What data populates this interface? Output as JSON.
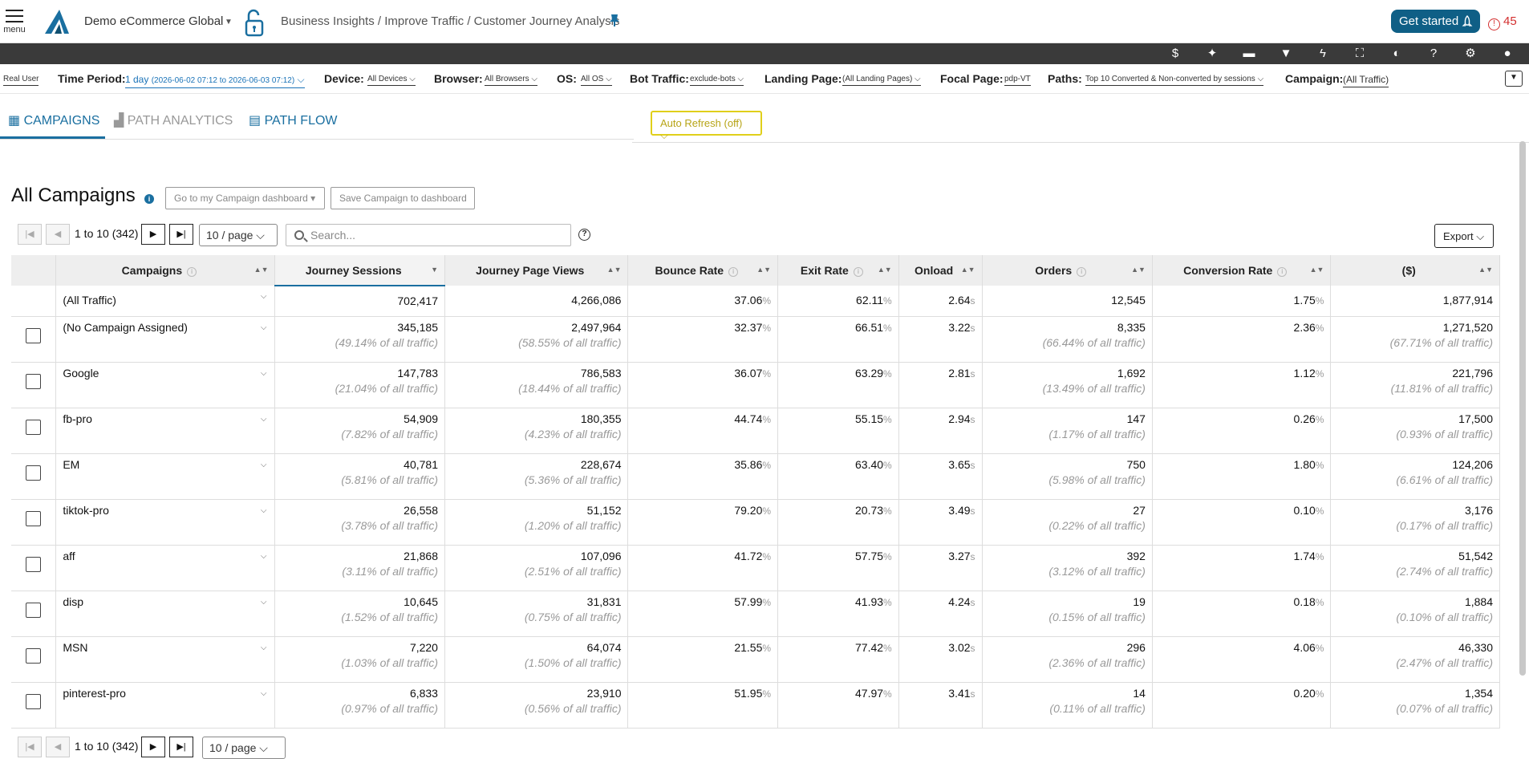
{
  "header": {
    "menu_label": "menu",
    "account": "Demo eCommerce Global",
    "breadcrumb": "Business Insights / Improve Traffic / Customer Journey Analysis",
    "get_started": "Get started",
    "alert_count": "45"
  },
  "toolbar_icons": [
    "dollar-icon",
    "sparkle-icon",
    "comment-icon",
    "filter-icon",
    "bolt-icon",
    "fullscreen-icon",
    "contrast-icon",
    "help-icon",
    "gear-icon",
    "user-icon"
  ],
  "filters": {
    "real_user": "Real User",
    "time_period_label": "Time Period:",
    "time_period_value": "1 day",
    "time_period_range": "(2026-06-02 07:12 to 2026-06-03 07:12)",
    "device_label": "Device:",
    "device_value": "All Devices",
    "browser_label": "Browser:",
    "browser_value": "All Browsers",
    "os_label": "OS:",
    "os_value": "All OS",
    "bot_label": "Bot Traffic:",
    "bot_value": "exclude-bots",
    "landing_label": "Landing Page:",
    "landing_value": "(All Landing Pages)",
    "focal_label": "Focal Page:",
    "focal_value": "pdp-VT",
    "paths_label": "Paths:",
    "paths_value": "Top 10 Converted & Non-converted by sessions",
    "campaign_label": "Campaign:",
    "campaign_value": "(All Traffic)"
  },
  "tabs": [
    "CAMPAIGNS",
    "PATH ANALYTICS",
    "PATH FLOW"
  ],
  "auto_refresh": "Auto Refresh (off)",
  "section": {
    "title": "All Campaigns",
    "goto_button": "Go to my Campaign dashboard",
    "save_button": "Save Campaign to dashboard",
    "search_placeholder": "Search...",
    "export": "Export"
  },
  "pager": {
    "range": "1 to 10 (342)",
    "page_size": "10 / page"
  },
  "table": {
    "columns": [
      "Campaigns",
      "Journey Sessions",
      "Journey Page Views",
      "Bounce Rate",
      "Exit Rate",
      "Onload",
      "Orders",
      "Conversion Rate",
      "($)"
    ],
    "total": {
      "name": "(All Traffic)",
      "sessions": "702,417",
      "pageviews": "4,266,086",
      "bounce": "37.06",
      "exit": "62.11",
      "onload": "2.64",
      "orders": "12,545",
      "conv": "1.75",
      "revenue": "1,877,914"
    },
    "rows": [
      {
        "name": "(No Campaign Assigned)",
        "sessions": "345,185",
        "sessions_pct": "(49.14% of all traffic)",
        "pageviews": "2,497,964",
        "pageviews_pct": "(58.55% of all traffic)",
        "bounce": "32.37",
        "exit": "66.51",
        "onload": "3.22",
        "orders": "8,335",
        "orders_pct": "(66.44% of all traffic)",
        "conv": "2.36",
        "revenue": "1,271,520",
        "revenue_pct": "(67.71% of all traffic)"
      },
      {
        "name": "Google",
        "sessions": "147,783",
        "sessions_pct": "(21.04% of all traffic)",
        "pageviews": "786,583",
        "pageviews_pct": "(18.44% of all traffic)",
        "bounce": "36.07",
        "exit": "63.29",
        "onload": "2.81",
        "orders": "1,692",
        "orders_pct": "(13.49% of all traffic)",
        "conv": "1.12",
        "revenue": "221,796",
        "revenue_pct": "(11.81% of all traffic)"
      },
      {
        "name": "fb-pro",
        "sessions": "54,909",
        "sessions_pct": "(7.82% of all traffic)",
        "pageviews": "180,355",
        "pageviews_pct": "(4.23% of all traffic)",
        "bounce": "44.74",
        "exit": "55.15",
        "onload": "2.94",
        "orders": "147",
        "orders_pct": "(1.17% of all traffic)",
        "conv": "0.26",
        "revenue": "17,500",
        "revenue_pct": "(0.93% of all traffic)"
      },
      {
        "name": "EM",
        "sessions": "40,781",
        "sessions_pct": "(5.81% of all traffic)",
        "pageviews": "228,674",
        "pageviews_pct": "(5.36% of all traffic)",
        "bounce": "35.86",
        "exit": "63.40",
        "onload": "3.65",
        "orders": "750",
        "orders_pct": "(5.98% of all traffic)",
        "conv": "1.80",
        "revenue": "124,206",
        "revenue_pct": "(6.61% of all traffic)"
      },
      {
        "name": "tiktok-pro",
        "sessions": "26,558",
        "sessions_pct": "(3.78% of all traffic)",
        "pageviews": "51,152",
        "pageviews_pct": "(1.20% of all traffic)",
        "bounce": "79.20",
        "exit": "20.73",
        "onload": "3.49",
        "orders": "27",
        "orders_pct": "(0.22% of all traffic)",
        "conv": "0.10",
        "revenue": "3,176",
        "revenue_pct": "(0.17% of all traffic)"
      },
      {
        "name": "aff",
        "sessions": "21,868",
        "sessions_pct": "(3.11% of all traffic)",
        "pageviews": "107,096",
        "pageviews_pct": "(2.51% of all traffic)",
        "bounce": "41.72",
        "exit": "57.75",
        "onload": "3.27",
        "orders": "392",
        "orders_pct": "(3.12% of all traffic)",
        "conv": "1.74",
        "revenue": "51,542",
        "revenue_pct": "(2.74% of all traffic)"
      },
      {
        "name": "disp",
        "sessions": "10,645",
        "sessions_pct": "(1.52% of all traffic)",
        "pageviews": "31,831",
        "pageviews_pct": "(0.75% of all traffic)",
        "bounce": "57.99",
        "exit": "41.93",
        "onload": "4.24",
        "orders": "19",
        "orders_pct": "(0.15% of all traffic)",
        "conv": "0.18",
        "revenue": "1,884",
        "revenue_pct": "(0.10% of all traffic)"
      },
      {
        "name": "MSN",
        "sessions": "7,220",
        "sessions_pct": "(1.03% of all traffic)",
        "pageviews": "64,074",
        "pageviews_pct": "(1.50% of all traffic)",
        "bounce": "21.55",
        "exit": "77.42",
        "onload": "3.02",
        "orders": "296",
        "orders_pct": "(2.36% of all traffic)",
        "conv": "4.06",
        "revenue": "46,330",
        "revenue_pct": "(2.47% of all traffic)"
      },
      {
        "name": "pinterest-pro",
        "sessions": "6,833",
        "sessions_pct": "(0.97% of all traffic)",
        "pageviews": "23,910",
        "pageviews_pct": "(0.56% of all traffic)",
        "bounce": "51.95",
        "exit": "47.97",
        "onload": "3.41",
        "orders": "14",
        "orders_pct": "(0.11% of all traffic)",
        "conv": "0.20",
        "revenue": "1,354",
        "revenue_pct": "(0.07% of all traffic)"
      }
    ]
  },
  "units": {
    "percent": "%",
    "seconds": "s"
  },
  "colors": {
    "brand": "#1a6fa0",
    "button": "#0f5f86",
    "alert": "#d32f2f",
    "auto_refresh": "#e0cf1a"
  }
}
